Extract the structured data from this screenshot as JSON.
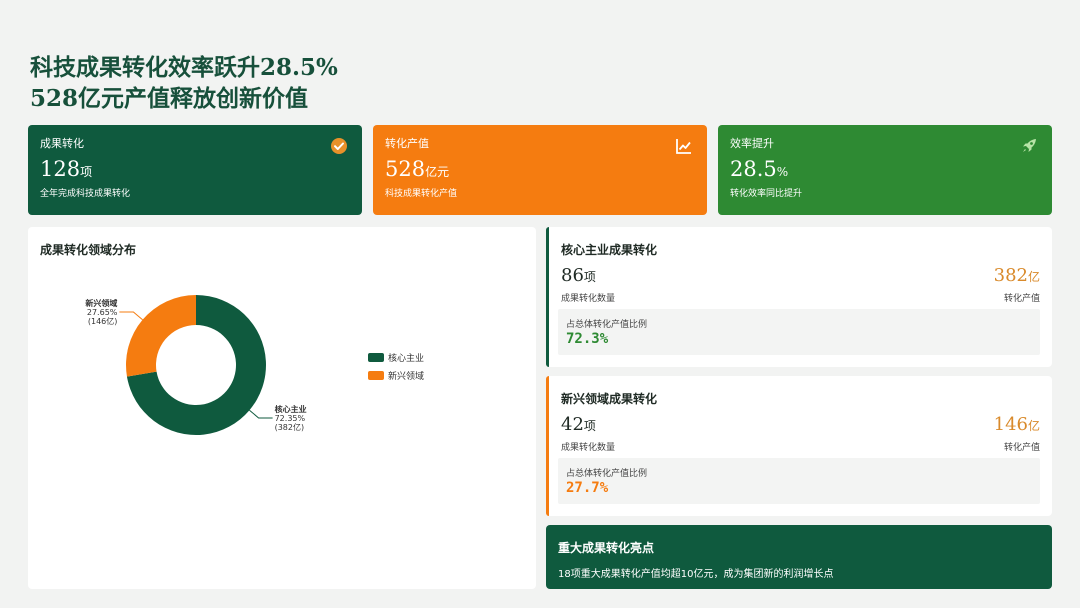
{
  "header": {
    "title_line1": "科技成果转化效率跃升28.5%",
    "title_line2": "528亿元产值释放创新价值"
  },
  "kpis": [
    {
      "label": "成果转化",
      "value": "128",
      "unit": "项",
      "desc": "全年完成科技成果转化",
      "icon": "check-circle-icon",
      "color": "#0f5a3e"
    },
    {
      "label": "转化产值",
      "value": "528",
      "unit": "亿元",
      "desc": "科技成果转化产值",
      "icon": "line-chart-icon",
      "color": "#f57c10"
    },
    {
      "label": "效率提升",
      "value": "28.5",
      "unit": "%",
      "desc": "转化效率同比提升",
      "icon": "rocket-icon",
      "color": "#2e8a33"
    }
  ],
  "distribution": {
    "title": "成果转化领域分布"
  },
  "chart_data": {
    "type": "pie",
    "categories": [
      "核心主业",
      "新兴领域"
    ],
    "values": [
      382,
      146
    ],
    "percents": [
      "72.35%",
      "27.65%"
    ],
    "value_labels": [
      "(382亿)",
      "(146亿)"
    ],
    "colors": [
      "#0f5a3e",
      "#f57c10"
    ],
    "legend_position": "right"
  },
  "segments": [
    {
      "title": "核心主业成果转化",
      "count": "86",
      "count_unit": "项",
      "count_label": "成果转化数量",
      "value": "382",
      "value_unit": "亿",
      "value_label": "转化产值",
      "ratio_label": "占总体转化产值比例",
      "ratio": "72.3%",
      "accent": "#0f5a3e",
      "value_color": "#d98a2b",
      "ratio_color": "#2e8a33"
    },
    {
      "title": "新兴领域成果转化",
      "count": "42",
      "count_unit": "项",
      "count_label": "成果转化数量",
      "value": "146",
      "value_unit": "亿",
      "value_label": "转化产值",
      "ratio_label": "占总体转化产值比例",
      "ratio": "27.7%",
      "accent": "#f57c10",
      "value_color": "#d98a2b",
      "ratio_color": "#f57c10"
    }
  ],
  "highlight": {
    "title": "重大成果转化亮点",
    "desc": "18项重大成果转化产值均超10亿元，成为集团新的利润增长点"
  }
}
